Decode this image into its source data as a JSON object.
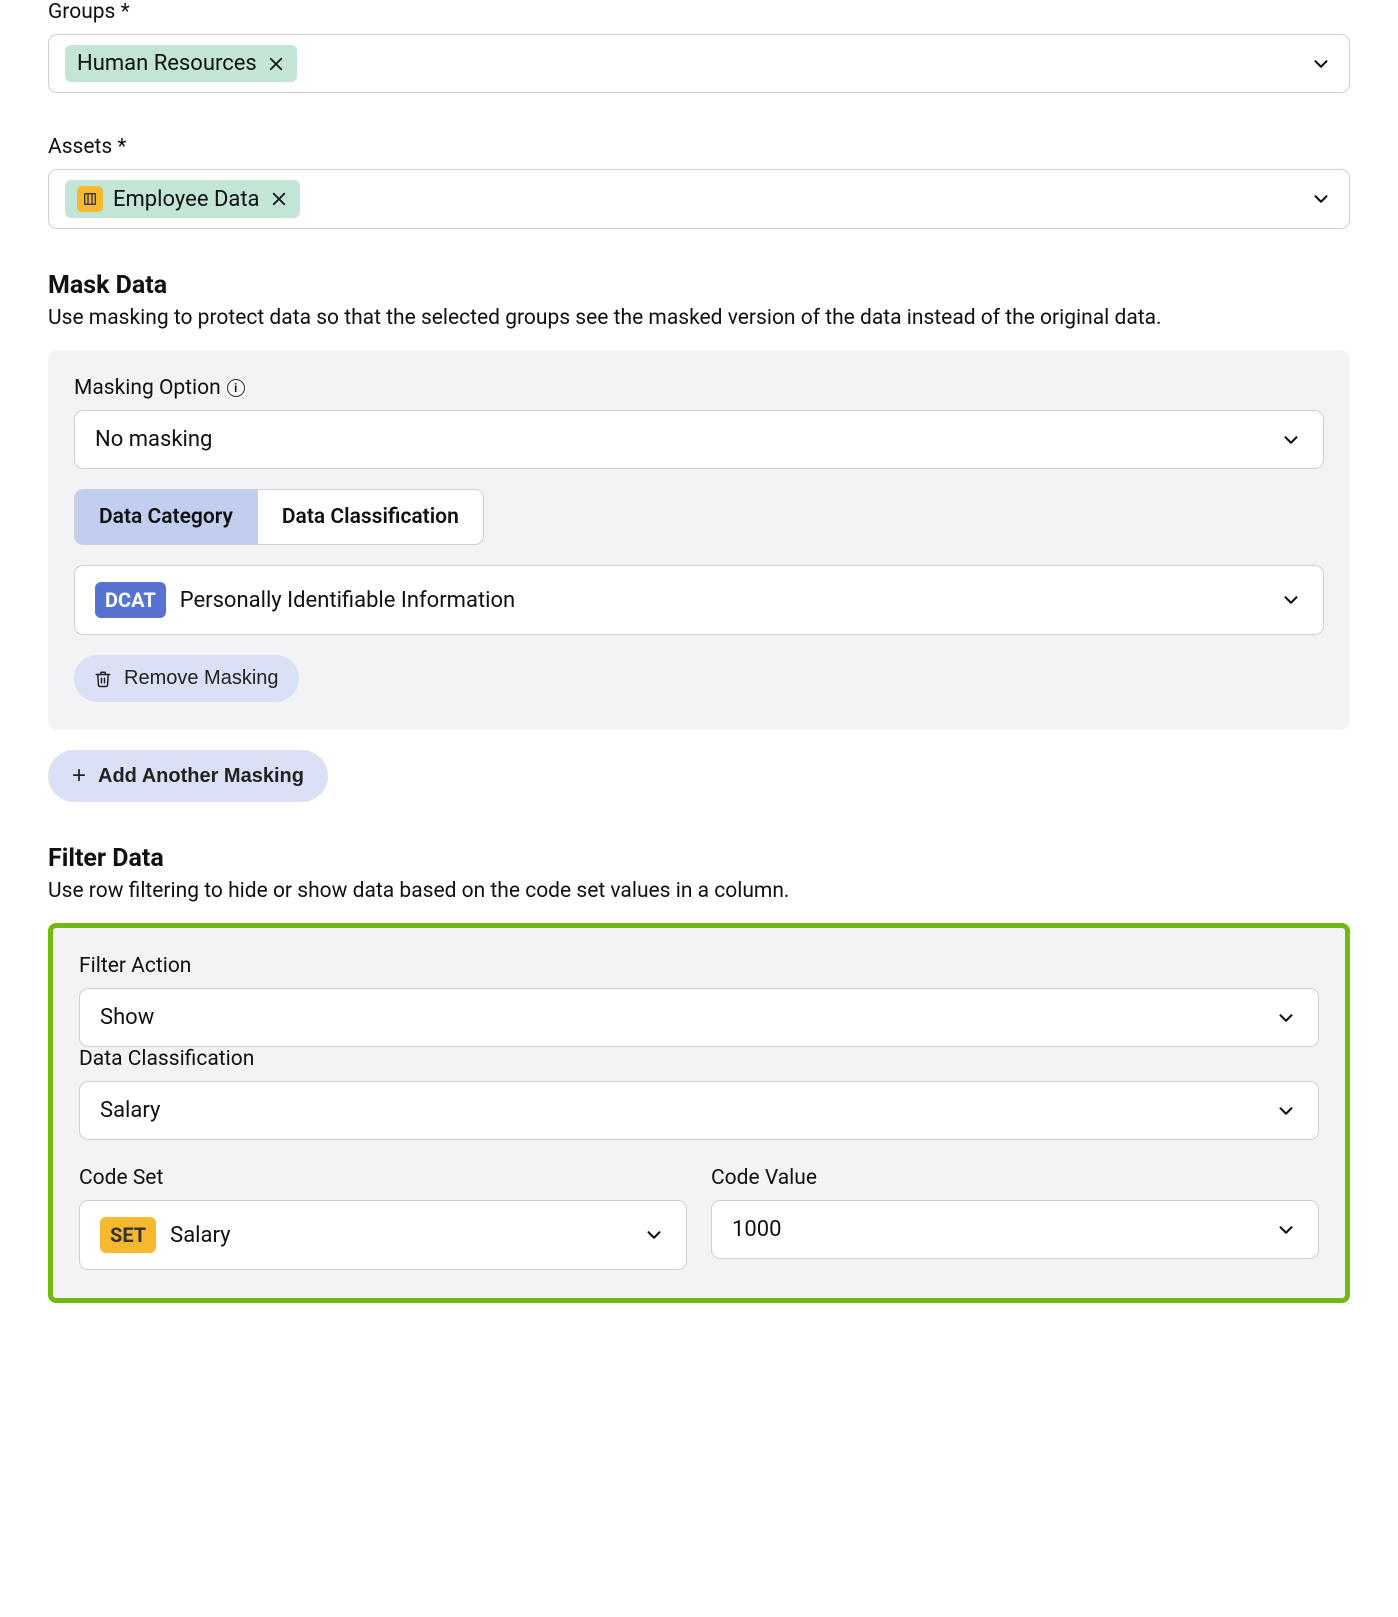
{
  "groups": {
    "label": "Groups *",
    "chips": [
      {
        "label": "Human Resources"
      }
    ]
  },
  "assets": {
    "label": "Assets *",
    "chips": [
      {
        "label": "Employee Data"
      }
    ]
  },
  "mask": {
    "title": "Mask Data",
    "desc": "Use masking to protect data so that the selected groups see the masked version of the data instead of the original data.",
    "option_label": "Masking Option",
    "option_value": "No masking",
    "tabs": {
      "category": "Data Category",
      "classification": "Data Classification"
    },
    "dcat_badge": "DCAT",
    "dcat_value": "Personally Identifiable Information",
    "remove_btn": "Remove Masking",
    "add_btn": "Add Another Masking"
  },
  "filter": {
    "title": "Filter Data",
    "desc": "Use row filtering to hide or show data based on the code set values in a column.",
    "action_label": "Filter Action",
    "action_value": "Show",
    "classification_label": "Data Classification",
    "classification_value": "Salary",
    "codeset_label": "Code Set",
    "codeset_badge": "SET",
    "codeset_value": "Salary",
    "codevalue_label": "Code Value",
    "codevalue_value": "1000"
  }
}
